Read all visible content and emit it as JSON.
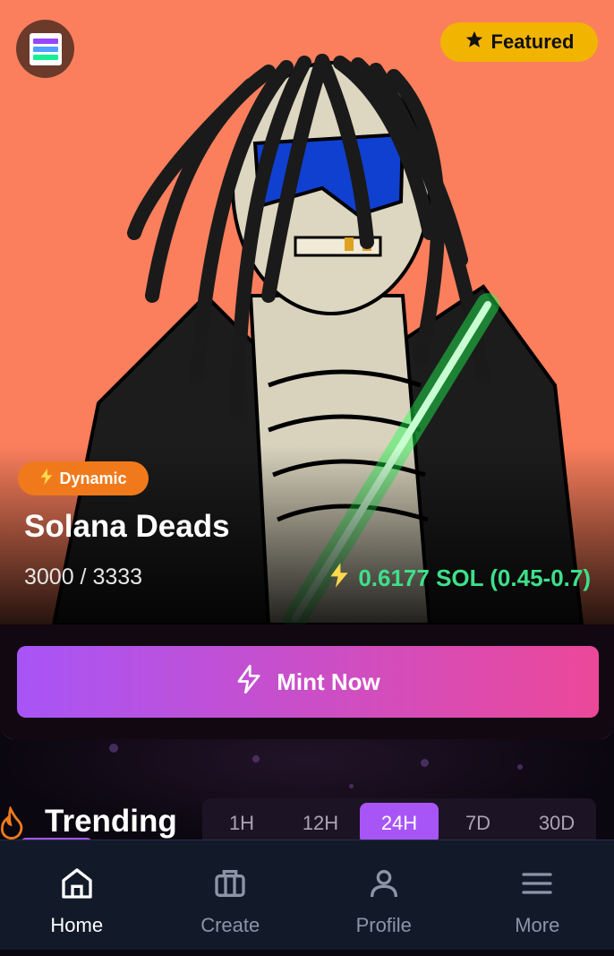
{
  "hero": {
    "featured_label": "Featured",
    "badge_label": "Dynamic",
    "title": "Solana Deads",
    "supply": "3000 / 3333",
    "price": "0.6177 SOL (0.45-0.7)",
    "colors": {
      "background": "#fb7f5d",
      "price": "#3ee08a",
      "badge": "#f07a1b",
      "featured": "#f1b400"
    }
  },
  "mint": {
    "button_label": "Mint Now"
  },
  "trending": {
    "title": "Trending",
    "ranges": [
      "1H",
      "12H",
      "24H",
      "7D",
      "30D"
    ],
    "active_range": "24H"
  },
  "nav": {
    "items": [
      {
        "label": "Home",
        "icon": "home-icon",
        "active": true
      },
      {
        "label": "Create",
        "icon": "briefcase-icon",
        "active": false
      },
      {
        "label": "Profile",
        "icon": "user-icon",
        "active": false
      },
      {
        "label": "More",
        "icon": "menu-icon",
        "active": false
      }
    ]
  }
}
